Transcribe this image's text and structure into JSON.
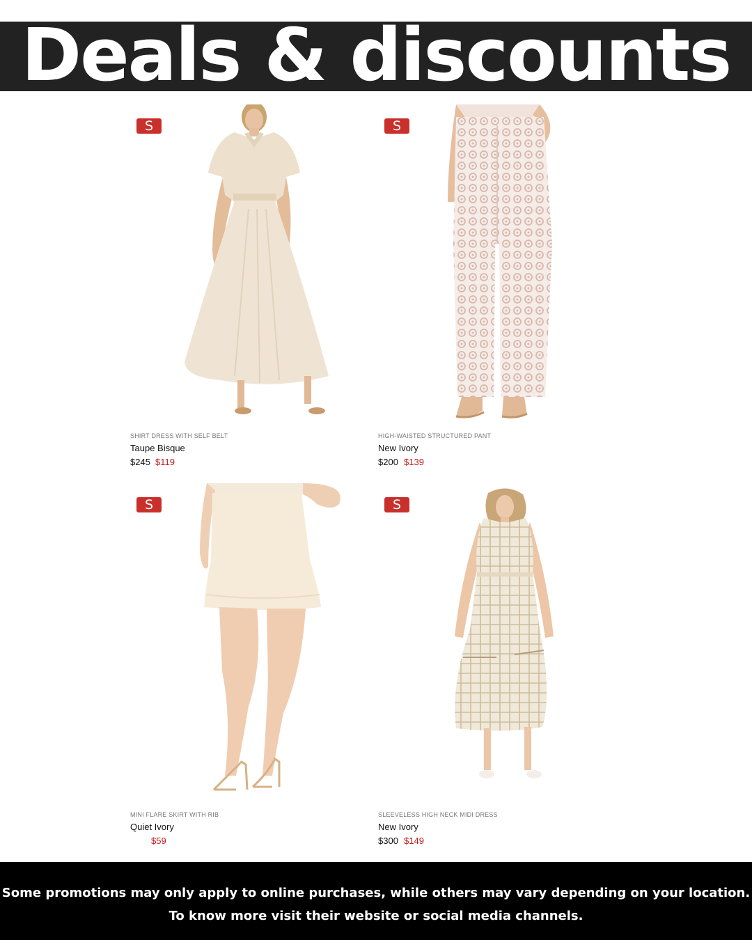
{
  "banner": {
    "title": "Deals & discounts"
  },
  "products": [
    {
      "badge": "S",
      "product_type": "SHIRT DRESS WITH SELF BELT",
      "color_name": "Taupe Bisque",
      "price_original": "$245",
      "price_sale": "$119",
      "image_icon": "shirt-dress-image"
    },
    {
      "badge": "S",
      "product_type": "HIGH-WAISTED STRUCTURED PANT",
      "color_name": "New Ivory",
      "price_original": "$200",
      "price_sale": "$139",
      "image_icon": "trousers-image"
    },
    {
      "badge": "S",
      "product_type": "MINI FLARE SKIRT WITH RIB",
      "color_name": "Quiet Ivory",
      "price_original": "",
      "price_sale": "$59",
      "image_icon": "mini-skirt-image"
    },
    {
      "badge": "S",
      "product_type": "SLEEVELESS HIGH NECK MIDI DRESS",
      "color_name": "New Ivory",
      "price_original": "$300",
      "price_sale": "$149",
      "image_icon": "midi-dress-image"
    }
  ],
  "footer": {
    "line1": "Some promotions may only apply to online purchases, while others may vary depending on your location.",
    "line2": "To know more visit their website or social media channels."
  },
  "colors": {
    "banner_bg": "#222222",
    "badge": "#c9302c",
    "sale_price": "#c41a1a",
    "footer_bg": "#000000"
  }
}
